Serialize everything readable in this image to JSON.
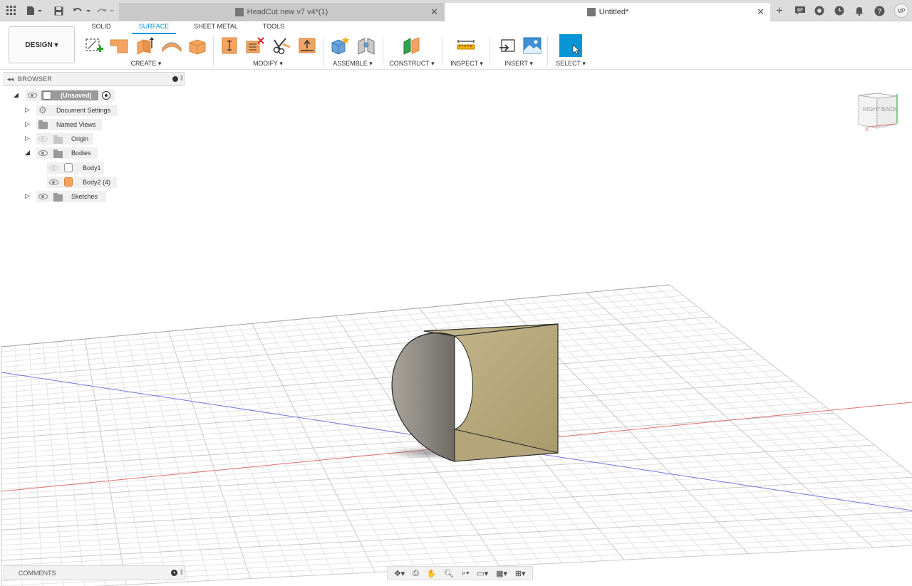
{
  "titlebar": {
    "tabs": [
      {
        "label": "HeadCut new v7 v4*(1)",
        "active": false
      },
      {
        "label": "Untitled*",
        "active": true
      }
    ],
    "user_initials": "VP",
    "icons": [
      "apps-grid-icon",
      "file-icon",
      "save-icon",
      "undo-icon",
      "redo-icon",
      "new-tab-icon",
      "job-status-icon",
      "extensions-icon",
      "clock-icon",
      "notification-bell-icon",
      "help-icon"
    ]
  },
  "toolbar": {
    "design_label": "DESIGN ▾",
    "workspace_tabs": [
      {
        "label": "SOLID",
        "active": false
      },
      {
        "label": "SURFACE",
        "active": true
      },
      {
        "label": "SHEET METAL",
        "active": false
      },
      {
        "label": "TOOLS",
        "active": false
      }
    ],
    "groups": {
      "create": "CREATE ▾",
      "modify": "MODIFY ▾",
      "assemble": "ASSEMBLE ▾",
      "construct": "CONSTRUCT ▾",
      "inspect": "INSPECT ▾",
      "insert": "INSERT ▾",
      "select": "SELECT ▾"
    },
    "colors": {
      "accent": "#0696d7",
      "surface_tool": "#f4a462"
    }
  },
  "browser": {
    "title": "BROWSER",
    "root": {
      "label": "(Unsaved)"
    },
    "items": [
      {
        "label": "Document Settings",
        "icon": "gear-icon"
      },
      {
        "label": "Named Views",
        "icon": "folder-icon"
      },
      {
        "label": "Origin",
        "icon": "folder-icon"
      },
      {
        "label": "Bodies",
        "icon": "folder-icon"
      },
      {
        "label": "Body1",
        "icon": "body-icon"
      },
      {
        "label": "Body2 (4)",
        "icon": "body-icon"
      },
      {
        "label": "Sketches",
        "icon": "folder-icon"
      }
    ]
  },
  "viewcube": {
    "right_label": "RIGHT",
    "back_label": "BACK",
    "x_label": "X"
  },
  "comments": {
    "label": "COMMENTS"
  },
  "navbar": {
    "icons": [
      "orbit-icon",
      "look-at-icon",
      "pan-icon",
      "zoom-icon",
      "fit-icon",
      "display-settings-icon",
      "grid-settings-icon",
      "viewports-icon"
    ]
  }
}
